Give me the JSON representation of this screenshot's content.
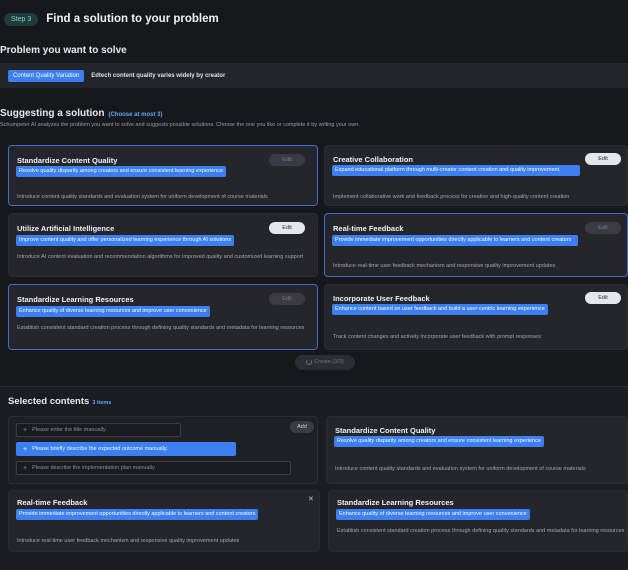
{
  "header": {
    "step": "Step 3",
    "title": "Find a solution to your problem"
  },
  "problem": {
    "heading": "Problem you want to solve",
    "tag": "Content Quality Variation",
    "description": "Edtech content quality varies widely by creator"
  },
  "suggest": {
    "heading": "Suggesting a solution",
    "hint": "(Choose at most 3)",
    "subtitle": "Schumpeter AI analyzes the problem you want to solve and suggests possible solutions. Choose the one you like or complete it by writing your own."
  },
  "cards": [
    {
      "title": "Standardize Content Quality",
      "highlight": "Resolve quality disparity among creators and ensure consistent learning experience",
      "description": "Introduce content quality standards and evaluation system for uniform development of course materials",
      "edit": "Edit"
    },
    {
      "title": "Creative Collaboration",
      "highlight": "Expand educational platform through multi-creator content creation and quality improvement",
      "description": "Implement collaborative work and feedback process for creative and high-quality content creation",
      "edit": "Edit"
    },
    {
      "title": "Utilize Artificial Intelligence",
      "highlight": "Improve content quality and offer personalized learning experience through AI solutions",
      "description": "Introduce AI content evaluation and recommendation algorithms for improved quality and customized learning support",
      "edit": "Edit"
    },
    {
      "title": "Real-time Feedback",
      "highlight": "Provide immediate improvement opportunities directly applicable to learners and content creators",
      "description": "Introduce real-time user feedback mechanism and responsive quality improvement updates",
      "edit": "Edit"
    },
    {
      "title": "Standardize Learning Resources",
      "highlight": "Enhance quality of diverse learning resources and improve user convenience",
      "description": "Establish consistent standard creation process through defining quality standards and metadata for learning resources",
      "edit": "Edit"
    },
    {
      "title": "Incorporate User Feedback",
      "highlight": "Enhance content based on user feedback and build a user-centric learning experience",
      "description": "Track content changes and actively incorporate user feedback with prompt responses",
      "edit": "Edit"
    }
  ],
  "create_button": "Create (3/3)",
  "selected": {
    "heading": "Selected contents",
    "count": "3 items",
    "form": {
      "title_placeholder": "Please enter the title manually.",
      "outcome_placeholder": "Please briefly describe the expected outcome manually.",
      "plan_placeholder": "Please describe the implementation plan manually.",
      "add": "Add"
    },
    "items": [
      {
        "title": "Standardize Content Quality",
        "highlight": "Resolve quality disparity among creators and ensure consistent learning experience",
        "description": "Introduce content quality standards and evaluation system for uniform development of course materials"
      },
      {
        "title": "Real-time Feedback",
        "highlight": "Provide immediate improvement opportunities directly applicable to learners and content creators",
        "description": "Introduce real-time user feedback mechanism and responsive quality improvement updates"
      },
      {
        "title": "Standardize Learning Resources",
        "highlight": "Enhance quality of diverse learning resources and improve user convenience",
        "description": "Establish consistent standard creation process through defining quality standards and metadata for learning resources"
      }
    ]
  }
}
